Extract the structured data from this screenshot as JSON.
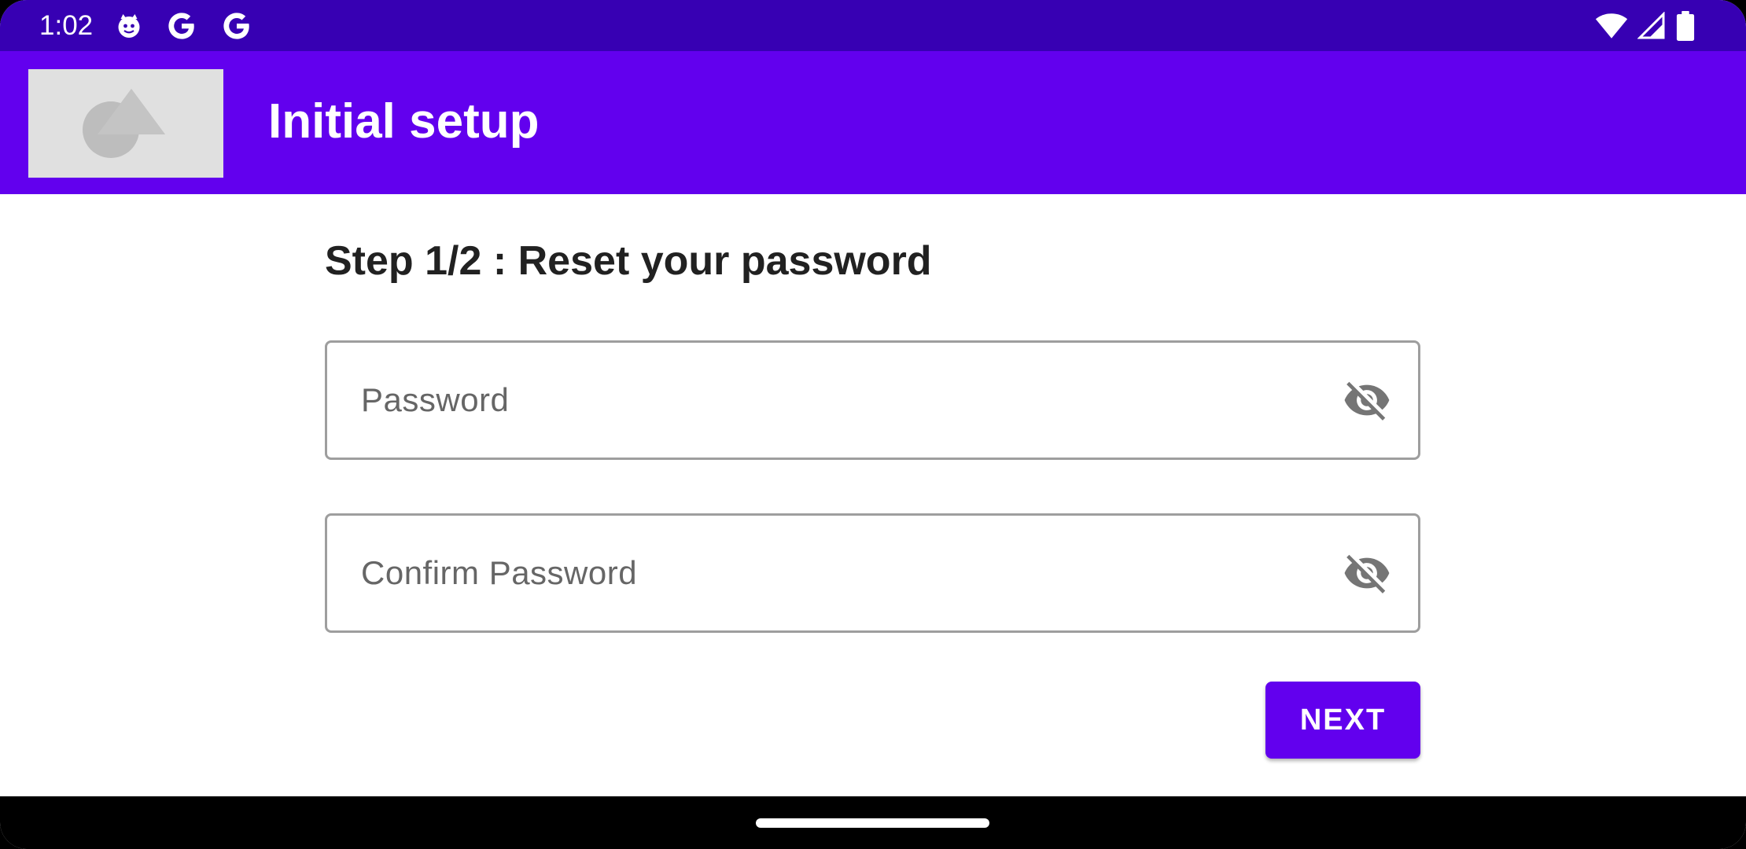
{
  "status_bar": {
    "time": "1:02",
    "left_icons": [
      "cat-face-icon",
      "google-g-icon",
      "google-g-icon"
    ],
    "right_icons": [
      "wifi-icon",
      "cell-signal-icon",
      "battery-icon"
    ]
  },
  "app_bar": {
    "title": "Initial setup",
    "logo": "placeholder-image-icon"
  },
  "main": {
    "step_title": "Step 1/2 : Reset your password",
    "password_field": {
      "placeholder": "Password",
      "value": "",
      "toggle_icon": "visibility-off-icon"
    },
    "confirm_password_field": {
      "placeholder": "Confirm Password",
      "value": "",
      "toggle_icon": "visibility-off-icon"
    },
    "next_label": "NEXT"
  },
  "colors": {
    "status_bar": "#3700b3",
    "primary": "#6200ee",
    "text_dark": "#212121",
    "field_border": "#9e9e9e",
    "icon_gray": "#757575"
  }
}
